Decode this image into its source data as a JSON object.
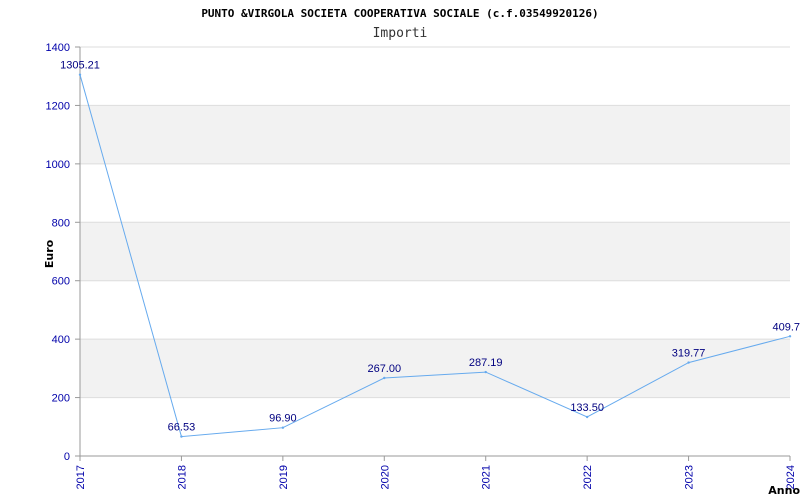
{
  "chart_data": {
    "type": "line",
    "title": "PUNTO &VIRGOLA SOCIETA COOPERATIVA SOCIALE (c.f.03549920126)",
    "subtitle": "Importi",
    "xlabel": "Anno",
    "ylabel": "Euro",
    "categories": [
      "2017",
      "2018",
      "2019",
      "2020",
      "2021",
      "2022",
      "2023",
      "2024"
    ],
    "series": [
      {
        "values": [
          1305.21,
          66.53,
          96.9,
          267.0,
          287.19,
          133.5,
          319.77,
          409.7
        ],
        "labels": [
          "1305.21",
          "66.53",
          "96.90",
          "267.00",
          "287.19",
          "133.50",
          "319.77",
          "409.7"
        ]
      }
    ],
    "ylim": [
      0,
      1400
    ],
    "yticks": [
      "0",
      "200",
      "400",
      "600",
      "800",
      "1000",
      "1200",
      "1400"
    ],
    "grid": true,
    "colors": {
      "line": "#66aaee",
      "band": "#f2f2f2",
      "grid": "#dddddd",
      "ticks": "#0000aa",
      "labels": "#000080"
    }
  }
}
